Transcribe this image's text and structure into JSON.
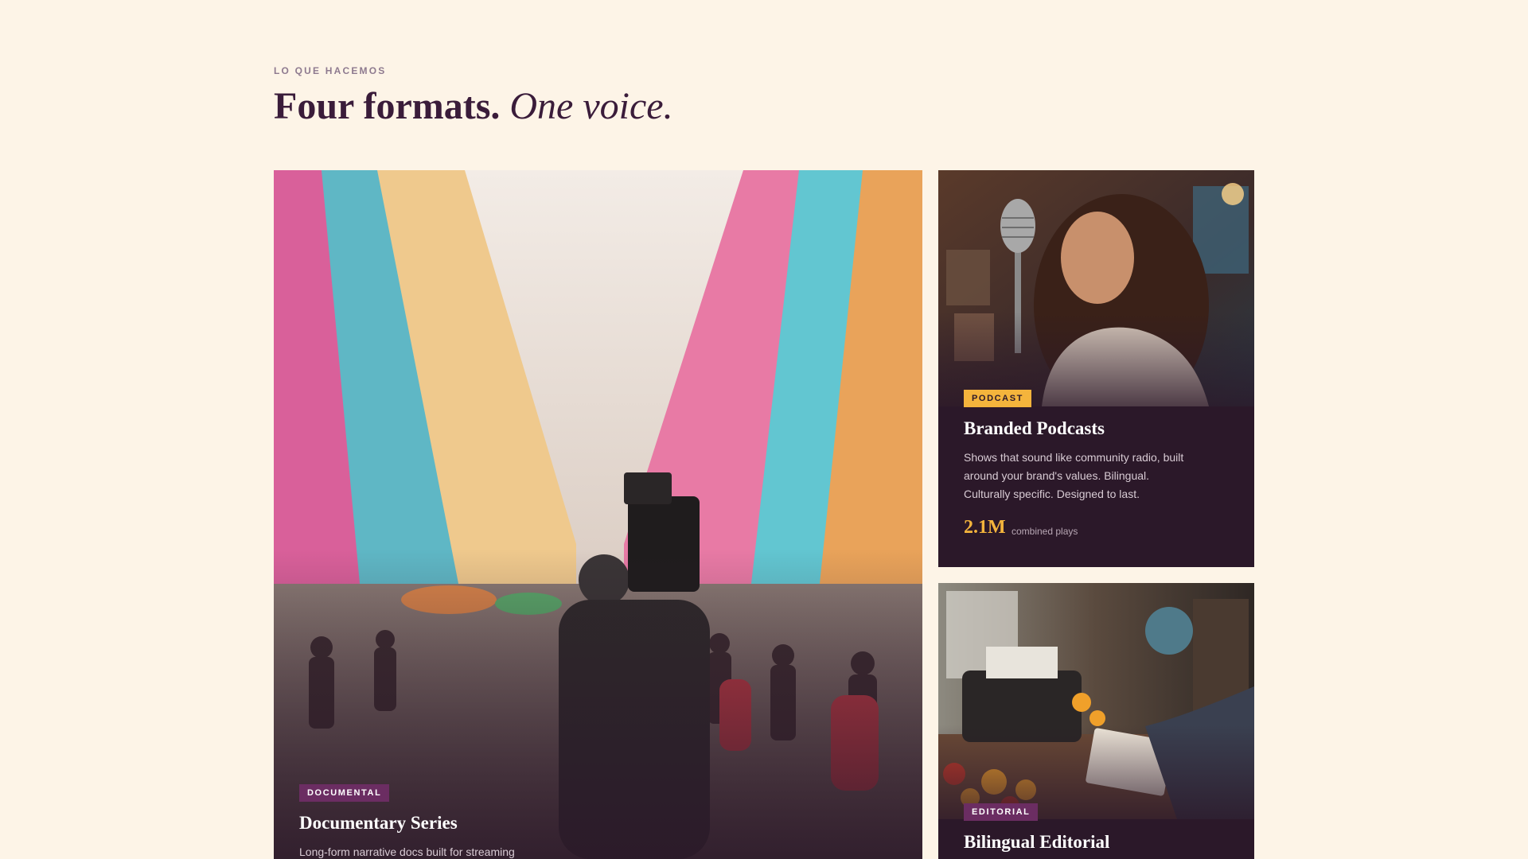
{
  "section": {
    "eyebrow": "LO QUE HACEMOS",
    "headline_bold": "Four formats.",
    "headline_italic": "One voice."
  },
  "cards": {
    "documentary": {
      "badge": "DOCUMENTAL",
      "title": "Documentary Series",
      "description": "Long-form narrative docs built for streaming"
    },
    "podcast": {
      "badge": "PODCAST",
      "title": "Branded Podcasts",
      "description": "Shows that sound like community radio, built around your brand's values. Bilingual. Culturally specific. Designed to last.",
      "stat_value": "2.1M",
      "stat_label": "combined plays"
    },
    "editorial": {
      "badge": "EDITORIAL",
      "title": "Bilingual Editorial"
    }
  },
  "colors": {
    "background": "#fdf4e7",
    "heading": "#3a1c3a",
    "card_dark": "#2b1829",
    "badge_purple": "#6b2d62",
    "badge_yellow": "#f4b43c"
  }
}
